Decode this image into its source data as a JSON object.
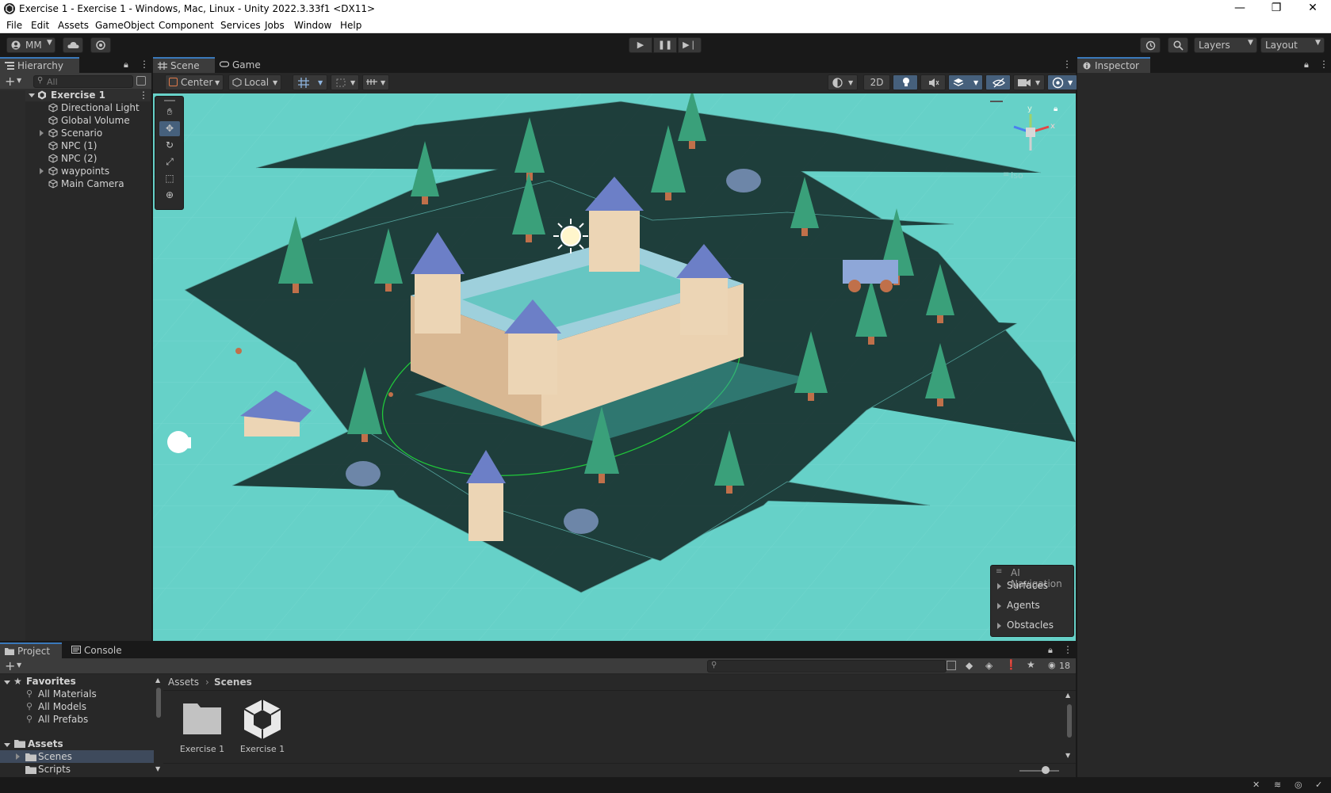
{
  "window": {
    "title": "Exercise 1 - Exercise 1 - Windows, Mac, Linux - Unity 2022.3.33f1 <DX11>",
    "minimize": "—",
    "maximize": "❐",
    "close": "✕"
  },
  "menu": [
    "File",
    "Edit",
    "Assets",
    "GameObject",
    "Component",
    "Services",
    "Jobs",
    "Window",
    "Help"
  ],
  "toolbar": {
    "account": "MM",
    "layers": "Layers",
    "layout": "Layout"
  },
  "hierarchy": {
    "tab": "Hierarchy",
    "search_placeholder": "All",
    "scene": "Exercise 1",
    "items": [
      {
        "label": "Directional Light"
      },
      {
        "label": "Global Volume"
      },
      {
        "label": "Scenario"
      },
      {
        "label": "NPC (1)"
      },
      {
        "label": "NPC (2)"
      },
      {
        "label": "waypoints"
      },
      {
        "label": "Main Camera"
      }
    ]
  },
  "scene_view": {
    "tabs": [
      "Scene",
      "Game"
    ],
    "pivot_mode": "Center",
    "pivot_rotation": "Local",
    "toggle_2d": "2D",
    "gizmo_projection": "Iso",
    "gizmo_axes": {
      "x": "x",
      "y": "y"
    }
  },
  "ai_navigation": {
    "title": "AI Navigation",
    "items": [
      "Surfaces",
      "Agents",
      "Obstacles"
    ]
  },
  "inspector": {
    "tab": "Inspector"
  },
  "project": {
    "tabs": [
      "Project",
      "Console"
    ],
    "favorites_label": "Favorites",
    "favorites": [
      "All Materials",
      "All Models",
      "All Prefabs"
    ],
    "assets_label": "Assets",
    "asset_folders": [
      "Scenes",
      "Scripts"
    ],
    "breadcrumb": [
      "Assets",
      "Scenes"
    ],
    "items": [
      {
        "name": "Exercise 1",
        "icon": "folder-icon"
      },
      {
        "name": "Exercise 1",
        "icon": "unity-scene-icon"
      }
    ],
    "hidden_count": "18"
  },
  "colors": {
    "ground": "#66d1c8",
    "accent": "#3a79bb",
    "panel": "#282828"
  }
}
